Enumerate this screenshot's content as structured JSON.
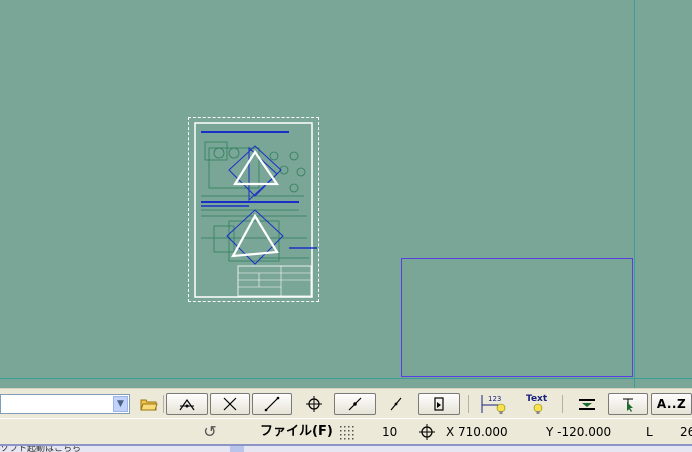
{
  "toolbar": {
    "combo_value": "",
    "tools": [
      {
        "name": "open-folder-icon"
      },
      {
        "name": "angle-bisector-icon"
      },
      {
        "name": "cross-lines-icon"
      },
      {
        "name": "diagonal-line-icon"
      },
      {
        "name": "target-cross-icon"
      },
      {
        "name": "line-point-icon"
      },
      {
        "name": "pointer-line-icon"
      },
      {
        "name": "layer-symbol-icon"
      },
      {
        "name": "dimension-123-icon"
      },
      {
        "name": "text-bulb-icon"
      },
      {
        "name": "layer-stack-icon"
      },
      {
        "name": "select-arrow-icon"
      },
      {
        "name": "az-sort-icon"
      }
    ],
    "text_label": "Text",
    "dim_label": "123",
    "az_label": "A..Z"
  },
  "status": {
    "file_menu": "ファイル(F)",
    "grid_value": "10",
    "x_coord": "X 710.000",
    "y_coord": "Y -120.000",
    "l_label": "L",
    "l_value": "26"
  },
  "taskstrip": {
    "label": "ソフト起動はこちら"
  },
  "colors": {
    "canvas_bg": "#7aa698",
    "guide": "#3d9e98",
    "view_rect": "#5a3fe0",
    "drawing_green": "#2e7d5a",
    "drawing_blue": "#1a2fc8"
  }
}
